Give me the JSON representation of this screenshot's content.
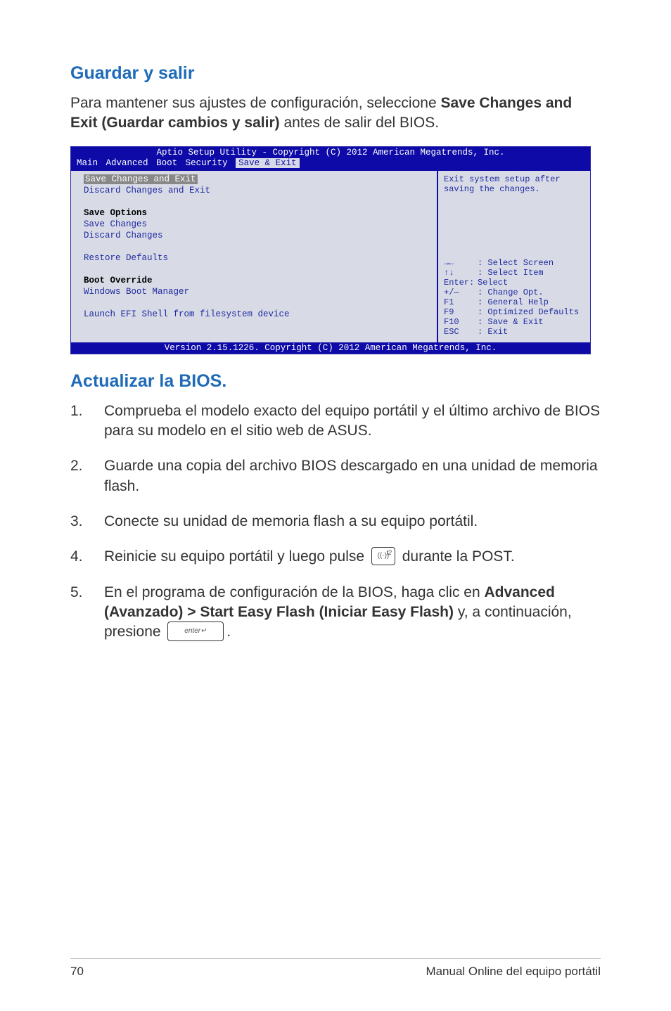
{
  "sections": {
    "save_exit": {
      "heading": "Guardar y salir",
      "para_pre": "Para mantener sus ajustes de configuración, seleccione ",
      "para_bold": "Save Changes and Exit (Guardar cambios y salir)",
      "para_post": " antes de salir del BIOS."
    },
    "update_bios": {
      "heading": "Actualizar la BIOS.",
      "items": {
        "1": "Comprueba el modelo exacto del equipo portátil y el último archivo de BIOS para su modelo en el sitio web de ASUS.",
        "2": "Guarde una copia del archivo BIOS descargado en una unidad de memoria flash.",
        "3": "Conecte su unidad de memoria flash a su equipo portátil.",
        "4_pre": "Reinicie su equipo portátil y luego pulse ",
        "4_post": " durante la POST.",
        "5_pre": "En el programa de configuración de la BIOS, haga clic en ",
        "5_bold": "Advanced (Avanzado) > Start Easy Flash (Iniciar Easy Flash)",
        "5_mid": " y, a continuación, presione ",
        "5_post": "."
      },
      "keys": {
        "f2_sym": "((·))",
        "f2_label": "f2",
        "enter_label": "enter"
      }
    }
  },
  "bios": {
    "title": "Aptio Setup Utility - Copyright (C) 2012 American Megatrends, Inc.",
    "tabs": {
      "main": "Main",
      "advanced": "Advanced",
      "boot": "Boot",
      "security": "Security",
      "save": "Save & Exit"
    },
    "left": {
      "selected": "Save Changes and Exit",
      "l2": "Discard Changes and Exit",
      "l3": "Save Options",
      "l4": "Save Changes",
      "l5": "Discard Changes",
      "l6": "Restore Defaults",
      "l7": "Boot Override",
      "l8": "Windows Boot Manager",
      "l9": "Launch EFI Shell from filesystem device"
    },
    "right": {
      "help1": "Exit system setup after",
      "help2": "saving the changes.",
      "k1a": "→←",
      "k1b": ": Select Screen",
      "k2a": "↑↓",
      "k2b": ": Select Item",
      "k3a": "Enter:",
      "k3b": "Select",
      "k4a": "+/—",
      "k4b": ": Change Opt.",
      "k5a": "F1",
      "k5b": ": General Help",
      "k6a": "F9",
      "k6b": ": Optimized Defaults",
      "k7a": "F10",
      "k7b": ": Save & Exit",
      "k8a": "ESC",
      "k8b": ": Exit"
    },
    "footer": "Version 2.15.1226. Copyright (C) 2012 American Megatrends, Inc."
  },
  "footer": {
    "page": "70",
    "label": "Manual Online del equipo portátil"
  }
}
